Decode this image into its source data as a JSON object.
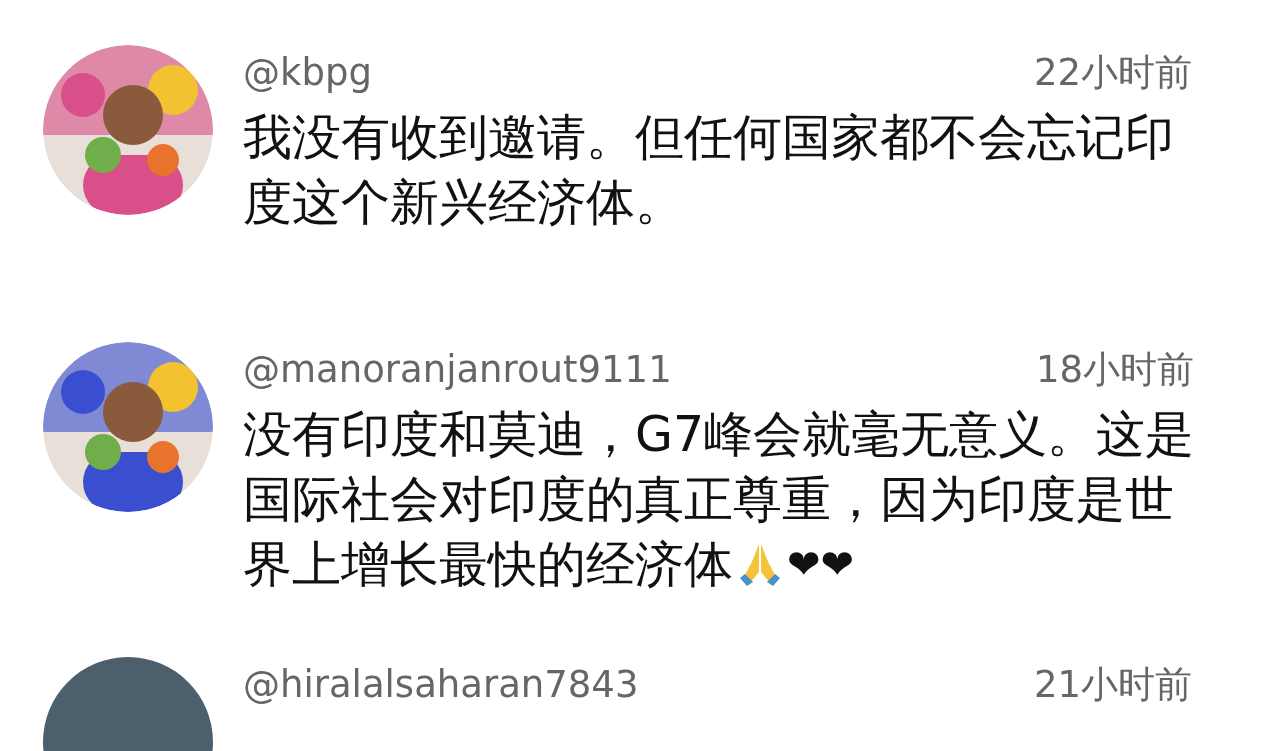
{
  "comments": [
    {
      "avatar": {
        "kind": "picture",
        "color": "#d94f8a"
      },
      "username": "@kbpg",
      "time": "22小时前",
      "lines": [
        "我没有收到邀请。但任何国家都不会忘记印",
        "度这个新兴经济体。"
      ]
    },
    {
      "avatar": {
        "kind": "picture",
        "color": "#3a4fd0"
      },
      "username": "@manoranjanrout9111",
      "time": "18小时前",
      "lines": [
        "没有印度和莫迪，G7峰会就毫无意义。这是",
        "国际社会对印度的真正尊重，因为印度是世",
        "界上增长最快的经济体"
      ],
      "praying_hands": true,
      "trailing": "❤❤"
    },
    {
      "avatar": {
        "kind": "plain",
        "color": "#4b5f6d"
      },
      "username": "@hiralalsaharan7843",
      "time": "21小时前"
    }
  ]
}
